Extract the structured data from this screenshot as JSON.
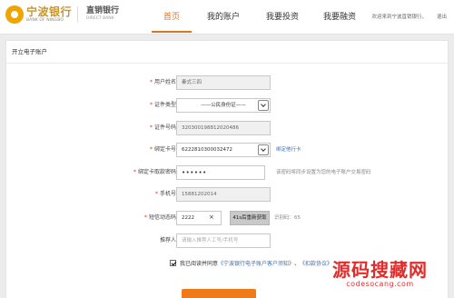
{
  "header": {
    "logo_cn": "宁波银行",
    "logo_en": "BANK OF NINGBO",
    "brand2_cn": "直销银行",
    "brand2_en": "DIRECT BANK",
    "nav": [
      "首页",
      "我的账户",
      "我要投资",
      "我要融资"
    ],
    "active_nav": "首页",
    "welcome": "欢迎来到宁波直销银行，",
    "exit": "退出"
  },
  "panel": {
    "title": "开立电子账户"
  },
  "form": {
    "name": {
      "label": "用户姓名：",
      "value": "秦式三四"
    },
    "id_type": {
      "label": "证件类型：",
      "value": "——公民身份证——"
    },
    "id_number": {
      "label": "证件号码：",
      "value": "320300198812020486"
    },
    "card": {
      "label": "绑定卡号：",
      "value": "6222810300032472",
      "link": "绑定他行卡"
    },
    "card_pwd": {
      "label": "绑定卡取款密码：",
      "value": "••••••",
      "hint": "该密码将同步设置为您的电子账户交易密码"
    },
    "phone": {
      "label": "手机号：",
      "value": "15881202014"
    },
    "sms": {
      "label": "短信动态码：",
      "value": "2222",
      "clear": "×",
      "button": "41s后重新获取",
      "hint": "识别码：65"
    },
    "referrer": {
      "label": "推荐人：",
      "placeholder": "请输入推荐人工号/手机号"
    },
    "agree_prefix": "我已阅读并同意",
    "agree_link1": "《宁波银行电子账户客户须知》",
    "agree_sep": "、",
    "agree_link2": "《扣款协议》"
  },
  "colors": {
    "accent": "#e0731d",
    "submit": "#f07a17",
    "link": "#3b6fb5",
    "watermark": "#e12c2c"
  },
  "watermark": {
    "cn": "源码搜藏网",
    "en": "codesocang.com"
  }
}
